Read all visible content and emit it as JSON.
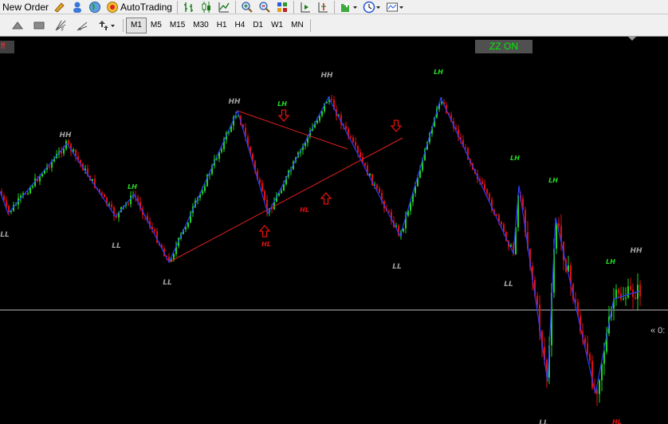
{
  "toolbar": {
    "new_order_label": "New Order",
    "autotrading_label": "AutoTrading"
  },
  "timeframes": [
    "M1",
    "M5",
    "M15",
    "M30",
    "H1",
    "H4",
    "D1",
    "W1",
    "MN"
  ],
  "active_timeframe": "M1",
  "chart": {
    "left_badge": "ff",
    "zz_button": "ZZ ON",
    "price_label": "« 0:",
    "colors": {
      "background": "#000000",
      "bull": "#22d322",
      "bear": "#e01010",
      "zigzag": "#2a3cff",
      "trendline": "#e02020",
      "hh_ll_label": "#a0a0a0",
      "lh_label": "#22dd22",
      "hl_label": "#e01010",
      "grid_line": "#c0c0c0"
    }
  },
  "swing_labels": [
    {
      "text": "HH",
      "kind": "hh"
    },
    {
      "text": "LL",
      "kind": "ll"
    },
    {
      "text": "LH",
      "kind": "lh"
    },
    {
      "text": "LL",
      "kind": "ll"
    },
    {
      "text": "LL",
      "kind": "ll"
    },
    {
      "text": "HH",
      "kind": "hh"
    },
    {
      "text": "LH",
      "kind": "lh"
    },
    {
      "text": "HL",
      "kind": "hl"
    },
    {
      "text": "HL",
      "kind": "hl"
    },
    {
      "text": "HH",
      "kind": "hh"
    },
    {
      "text": "LH",
      "kind": "lh"
    },
    {
      "text": "LL",
      "kind": "ll"
    },
    {
      "text": "LH",
      "kind": "lh"
    },
    {
      "text": "LH",
      "kind": "lh"
    },
    {
      "text": "LL",
      "kind": "ll"
    },
    {
      "text": "LH",
      "kind": "lh"
    },
    {
      "text": "HH",
      "kind": "hh"
    },
    {
      "text": "LL",
      "kind": "ll"
    },
    {
      "text": "HL",
      "kind": "hl"
    }
  ],
  "signal_arrows": [
    {
      "direction": "down",
      "name": "sell-arrow-1"
    },
    {
      "direction": "up",
      "name": "buy-arrow-1"
    },
    {
      "direction": "up",
      "name": "buy-arrow-2"
    },
    {
      "direction": "down",
      "name": "sell-arrow-2"
    }
  ]
}
